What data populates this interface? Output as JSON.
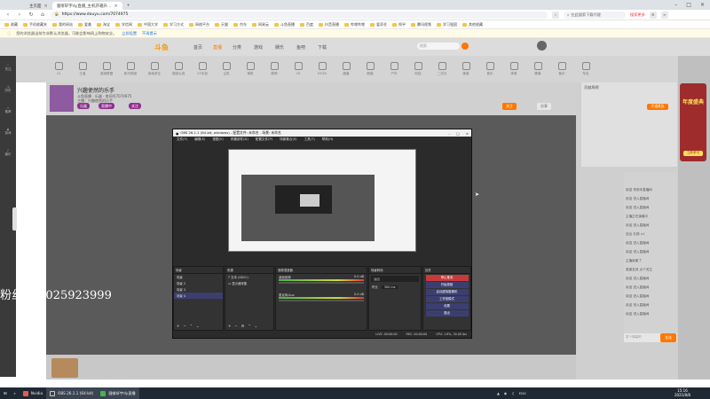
{
  "browser": {
    "tab_inactive": "主页面",
    "tab_active": "骚嗲轩宇dy直播_主机开箱升…",
    "address": "https://www.douyu.com/7074975",
    "search_placeholder": "在此搜索下载代理",
    "search_button": "搜索更多"
  },
  "bookmarks": [
    "收藏",
    "手机收藏夹",
    "我的网站",
    "爱美",
    "淘宝",
    "学信网",
    "中国大学",
    "学习方式",
    "网络平台",
    "天猫",
    "京东",
    "网易云",
    "斗鱼直播",
    "百度",
    "抖音直播",
    "哔哩哔哩",
    "爱奇艺",
    "知乎",
    "腾讯视频",
    "学习强国",
    "其他收藏"
  ],
  "notice": {
    "text": "您的浏览器当前为非默认浏览器，可能会影响网上购物安全。",
    "link1": "立即设置",
    "link2": "不再提示"
  },
  "douyu": {
    "logo": "斗鱼",
    "nav": [
      "首页",
      "直播",
      "分类",
      "游戏",
      "娱乐",
      "鱼吧",
      "下载"
    ],
    "search_placeholder": "搜索",
    "left_items": [
      "关注",
      "历史",
      "推荐",
      "游戏",
      "娱乐"
    ],
    "categories": [
      "12",
      "王者",
      "英雄联盟",
      "和平精英",
      "绝地求生",
      "穿越火线",
      "CF手游",
      "主机",
      "单机",
      "原神",
      "CS",
      "DOTA",
      "魔兽",
      "颜值",
      "户外",
      "科技",
      "二次元",
      "美食",
      "音乐",
      "体育",
      "赛事",
      "鱼乐",
      "车队"
    ],
    "room_title": "兴趣使然的乐手",
    "room_meta1": "斗鱼直播 · 乐器 · 房间号7074975",
    "room_meta2": "主播：兴趣使然的乐手",
    "tags": [
      "乐器",
      "直播中",
      "关注"
    ],
    "right_buttons": [
      "关注",
      "分享"
    ],
    "rank_title": "贡献周榜",
    "rank_button": "开通贵族",
    "chat_lines": [
      "欢迎 来到本直播间",
      "欢迎 进入直播间",
      "欢迎 进入直播间",
      "主播正在演奏中",
      "欢迎 进入直播间",
      "送出 礼物 ×1",
      "欢迎 进入直播间",
      "欢迎 进入直播间",
      "主播谢谢了",
      "感谢支持 点个关注",
      "欢迎 进入直播间",
      "欢迎 进入直播间",
      "欢迎 进入直播间",
      "欢迎 进入直播间",
      "欢迎 进入直播间"
    ],
    "chat_input_placeholder": "发个弹幕吧",
    "send_button": "发送",
    "promo_title": "年度盛典",
    "promo_sub": "立即参与"
  },
  "overlay_text": "粉丝群 1025923999",
  "obs": {
    "title": "OBS 26.1.1 (64-bit, windows) - 配置文件: 未命名 - 场景: 未命名",
    "menu": [
      "文件(F)",
      "编辑(E)",
      "视图(V)",
      "停靠部件(D)",
      "配置文件(P)",
      "场景集合(S)",
      "工具(T)",
      "帮助(H)"
    ],
    "scenes_header": "场景",
    "scenes": [
      "场景",
      "场景 2",
      "场景 3",
      "场景 4"
    ],
    "sources_header": "来源",
    "sources": [
      "文本 (GDI+)",
      "显示器采集"
    ],
    "mixer_header": "音频混音器",
    "mixer": [
      {
        "name": "桌面音频",
        "db": "0.0 dB"
      },
      {
        "name": "麦克风/Aux",
        "db": "0.0 dB"
      }
    ],
    "transition_header": "场景转场",
    "transition_value": "淡出",
    "duration_label": "时长",
    "duration_value": "300 ms",
    "controls_header": "控件",
    "controls": [
      "停止推流",
      "开始录制",
      "启动虚拟摄像机",
      "工作室模式",
      "设置",
      "退出"
    ],
    "status": {
      "live": "LIVE: 00:00:00",
      "rec": "REC: 00:00:00",
      "cpu": "CPU: 1.8%, 30.00 fps"
    }
  },
  "taskbar": {
    "items": [
      "Nvidia",
      "OBS 26.1.1 (64-bit)",
      "骚嗲轩宇dy直播"
    ],
    "tray": [
      "ENG"
    ],
    "time": "15:16",
    "date": "2021/8/8"
  },
  "colors": {
    "accent": "#ff7700",
    "obs_active": "#3b3f70",
    "stop_stream": "#c53a3a"
  }
}
